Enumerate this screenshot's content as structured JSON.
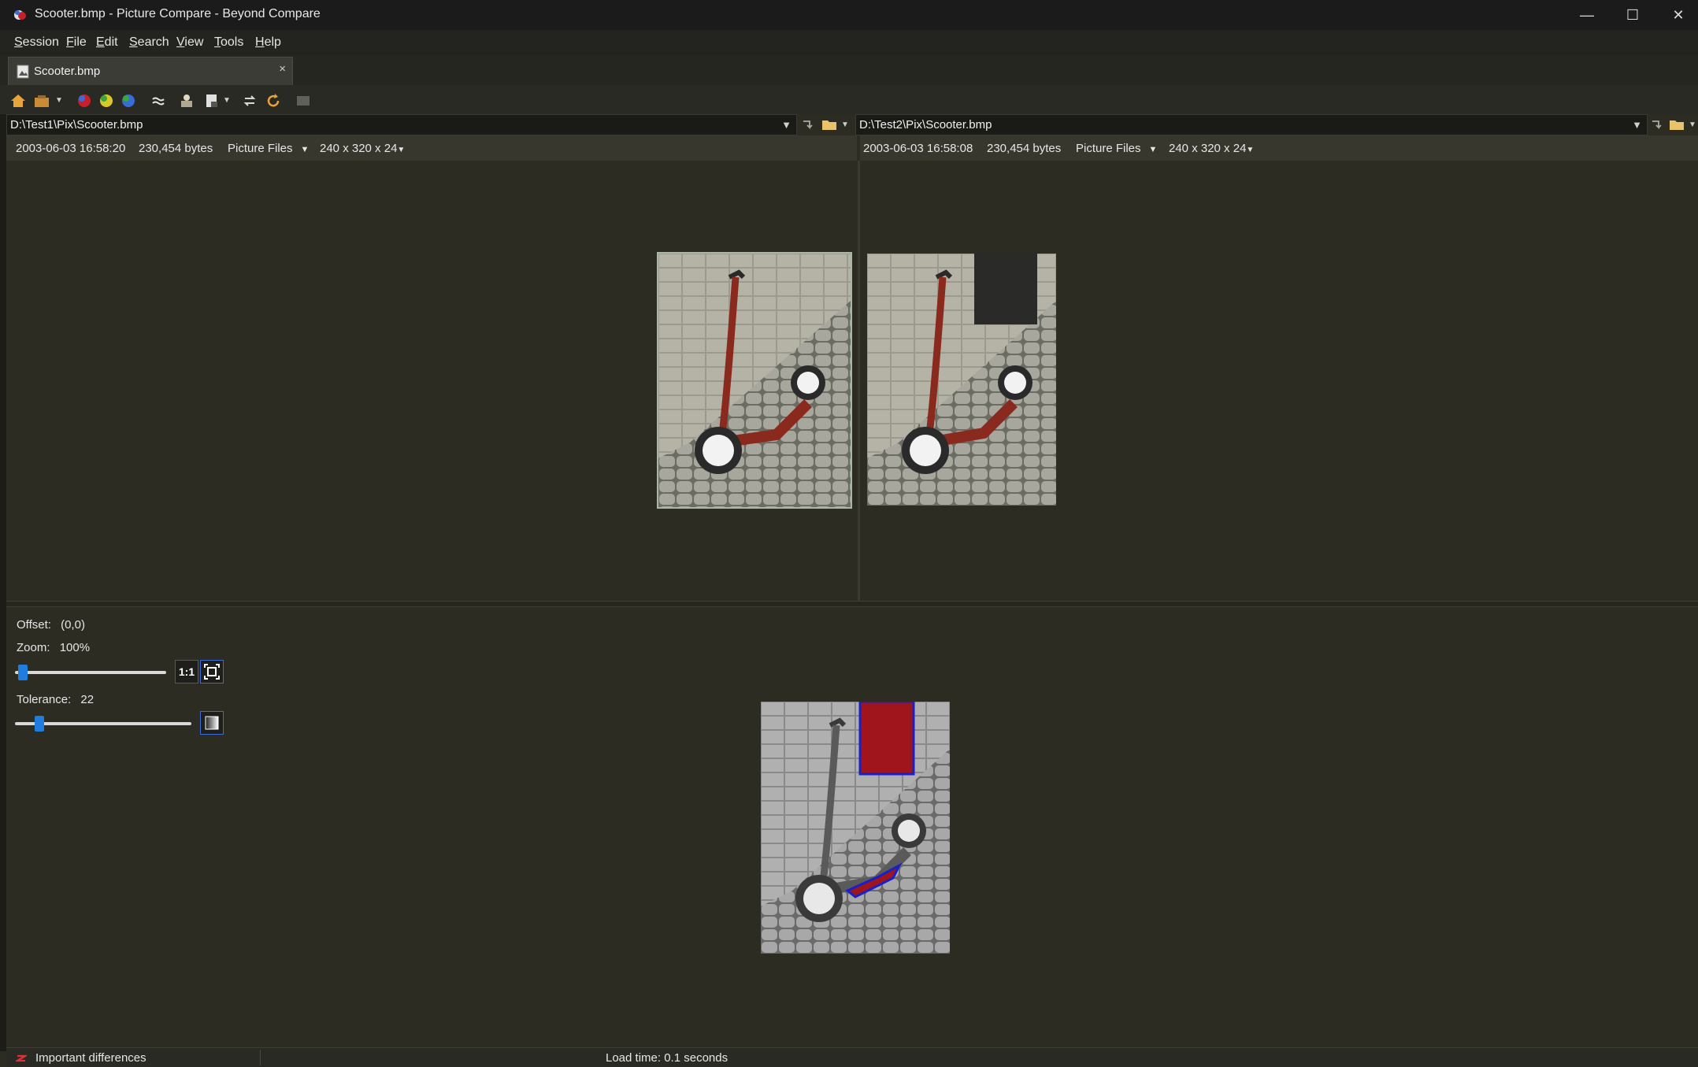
{
  "window": {
    "title": "Scooter.bmp - Picture Compare - Beyond Compare",
    "minimize": "—",
    "maximize": "☐",
    "close": "✕"
  },
  "menu": {
    "items": [
      {
        "label": "Session",
        "accel": "S",
        "rest": "ession"
      },
      {
        "label": "File",
        "accel": "F",
        "rest": "ile"
      },
      {
        "label": "Edit",
        "accel": "E",
        "rest": "dit"
      },
      {
        "label": "Search",
        "accel": "S",
        "rest": "earch"
      },
      {
        "label": "View",
        "accel": "V",
        "rest": "iew"
      },
      {
        "label": "Tools",
        "accel": "T",
        "rest": "ools"
      },
      {
        "label": "Help",
        "accel": "H",
        "rest": "elp"
      }
    ]
  },
  "tab": {
    "label": "Scooter.bmp",
    "close": "×"
  },
  "left": {
    "path": "D:\\Test1\\Pix\\Scooter.bmp",
    "date": "2003-06-03 16:58:20",
    "size": "230,454 bytes",
    "format": "Picture Files",
    "dimensions": "240 x 320 x 24"
  },
  "right": {
    "path": "D:\\Test2\\Pix\\Scooter.bmp",
    "date": "2003-06-03 16:58:08",
    "size": "230,454 bytes",
    "format": "Picture Files",
    "dimensions": "240 x 320 x 24"
  },
  "controls": {
    "offset_label": "Offset:",
    "offset_value": "(0,0)",
    "zoom_label": "Zoom:",
    "zoom_value": "100%",
    "zoom_slider_fraction": 0.02,
    "one_to_one": "1:1",
    "tolerance_label": "Tolerance:",
    "tolerance_value": "22",
    "tolerance_slider_fraction": 0.12
  },
  "status": {
    "left": "Important differences",
    "center": "Load time: 0.1 seconds"
  },
  "colors": {
    "accent": "#1f7de0",
    "background": "#2d2c22",
    "difference_red": "#a0141c",
    "difference_blue": "#1a20c8"
  }
}
